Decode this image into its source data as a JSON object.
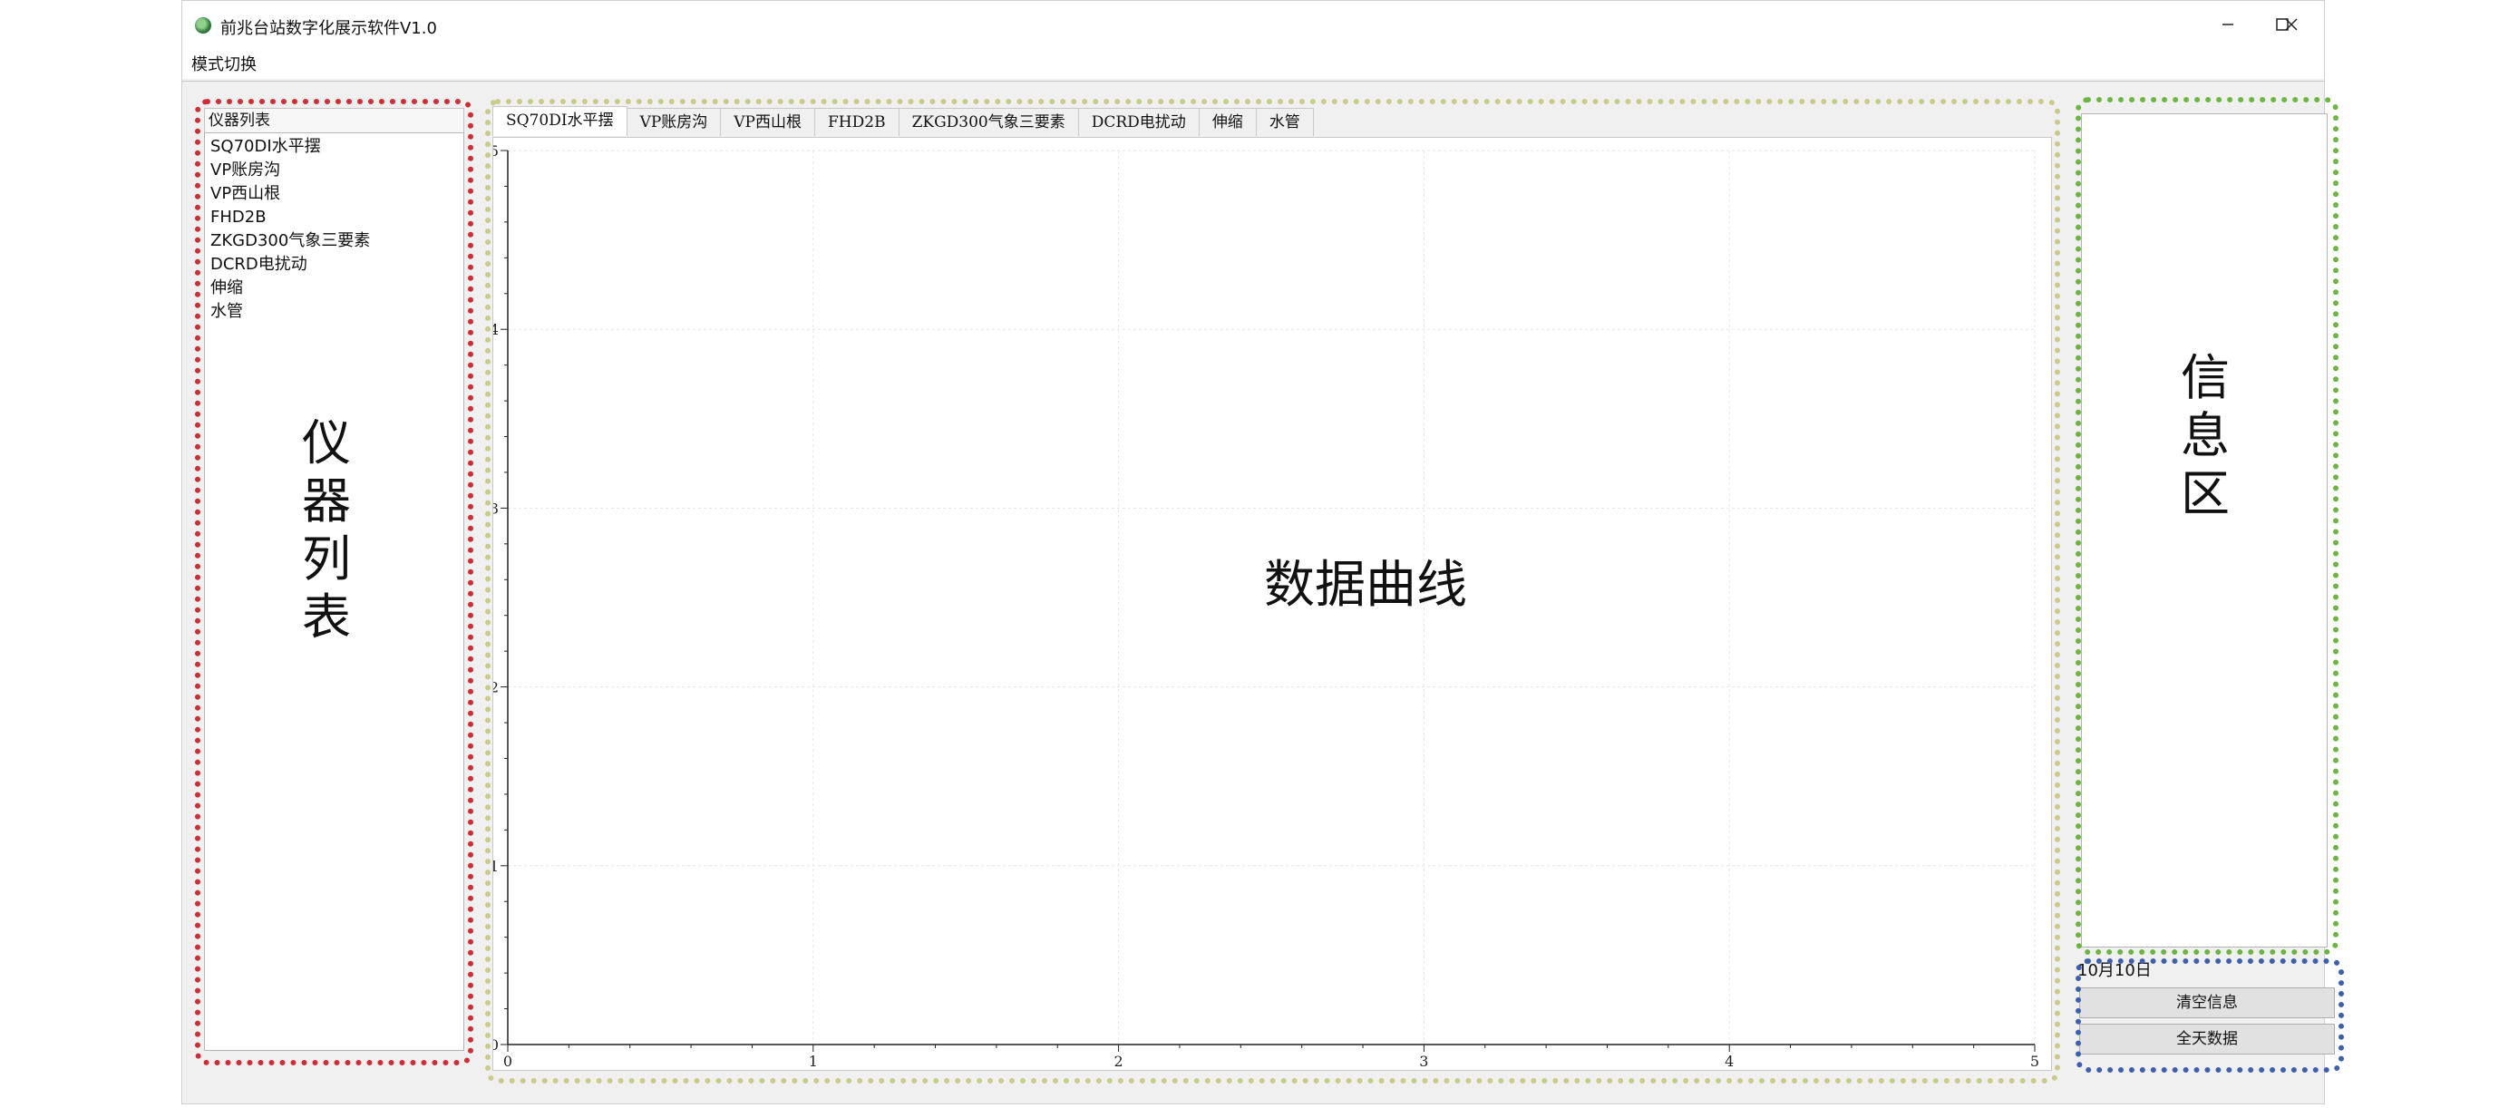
{
  "window": {
    "title": "前兆台站数字化展示软件V1.0"
  },
  "menu": {
    "mode_switch": "模式切换"
  },
  "instrument_list": {
    "header": "仪器列表",
    "items": [
      "SQ70DI水平摆",
      "VP账房沟",
      "VP西山根",
      "FHD2B",
      "ZKGD300气象三要素",
      "DCRD电扰动",
      "伸缩",
      "水管"
    ],
    "annotation": [
      "仪",
      "器",
      "列",
      "表"
    ]
  },
  "tabs": {
    "items": [
      "SQ70DI水平摆",
      "VP账房沟",
      "VP西山根",
      "FHD2B",
      "ZKGD300气象三要素",
      "DCRD电扰动",
      "伸缩",
      "水管"
    ],
    "active_index": 0
  },
  "chart": {
    "annotation": "数据曲线"
  },
  "chart_data": {
    "type": "line",
    "series": [],
    "xlim": [
      0,
      5
    ],
    "ylim": [
      0,
      5
    ],
    "x_ticks": [
      "0",
      "1",
      "2",
      "3",
      "4",
      "5"
    ],
    "y_ticks": [
      "0",
      "1",
      "2",
      "3",
      "4",
      "5"
    ],
    "grid": true
  },
  "info": {
    "annotation": [
      "信",
      "息",
      "区"
    ],
    "date": "10月10日",
    "clear_button": "清空信息",
    "all_day_button": "全天数据"
  },
  "colors": {
    "annotation_red": "#d22b36",
    "annotation_yellow": "#c8cc86",
    "annotation_green": "#6ab63f",
    "annotation_blue": "#3c5fb0"
  }
}
